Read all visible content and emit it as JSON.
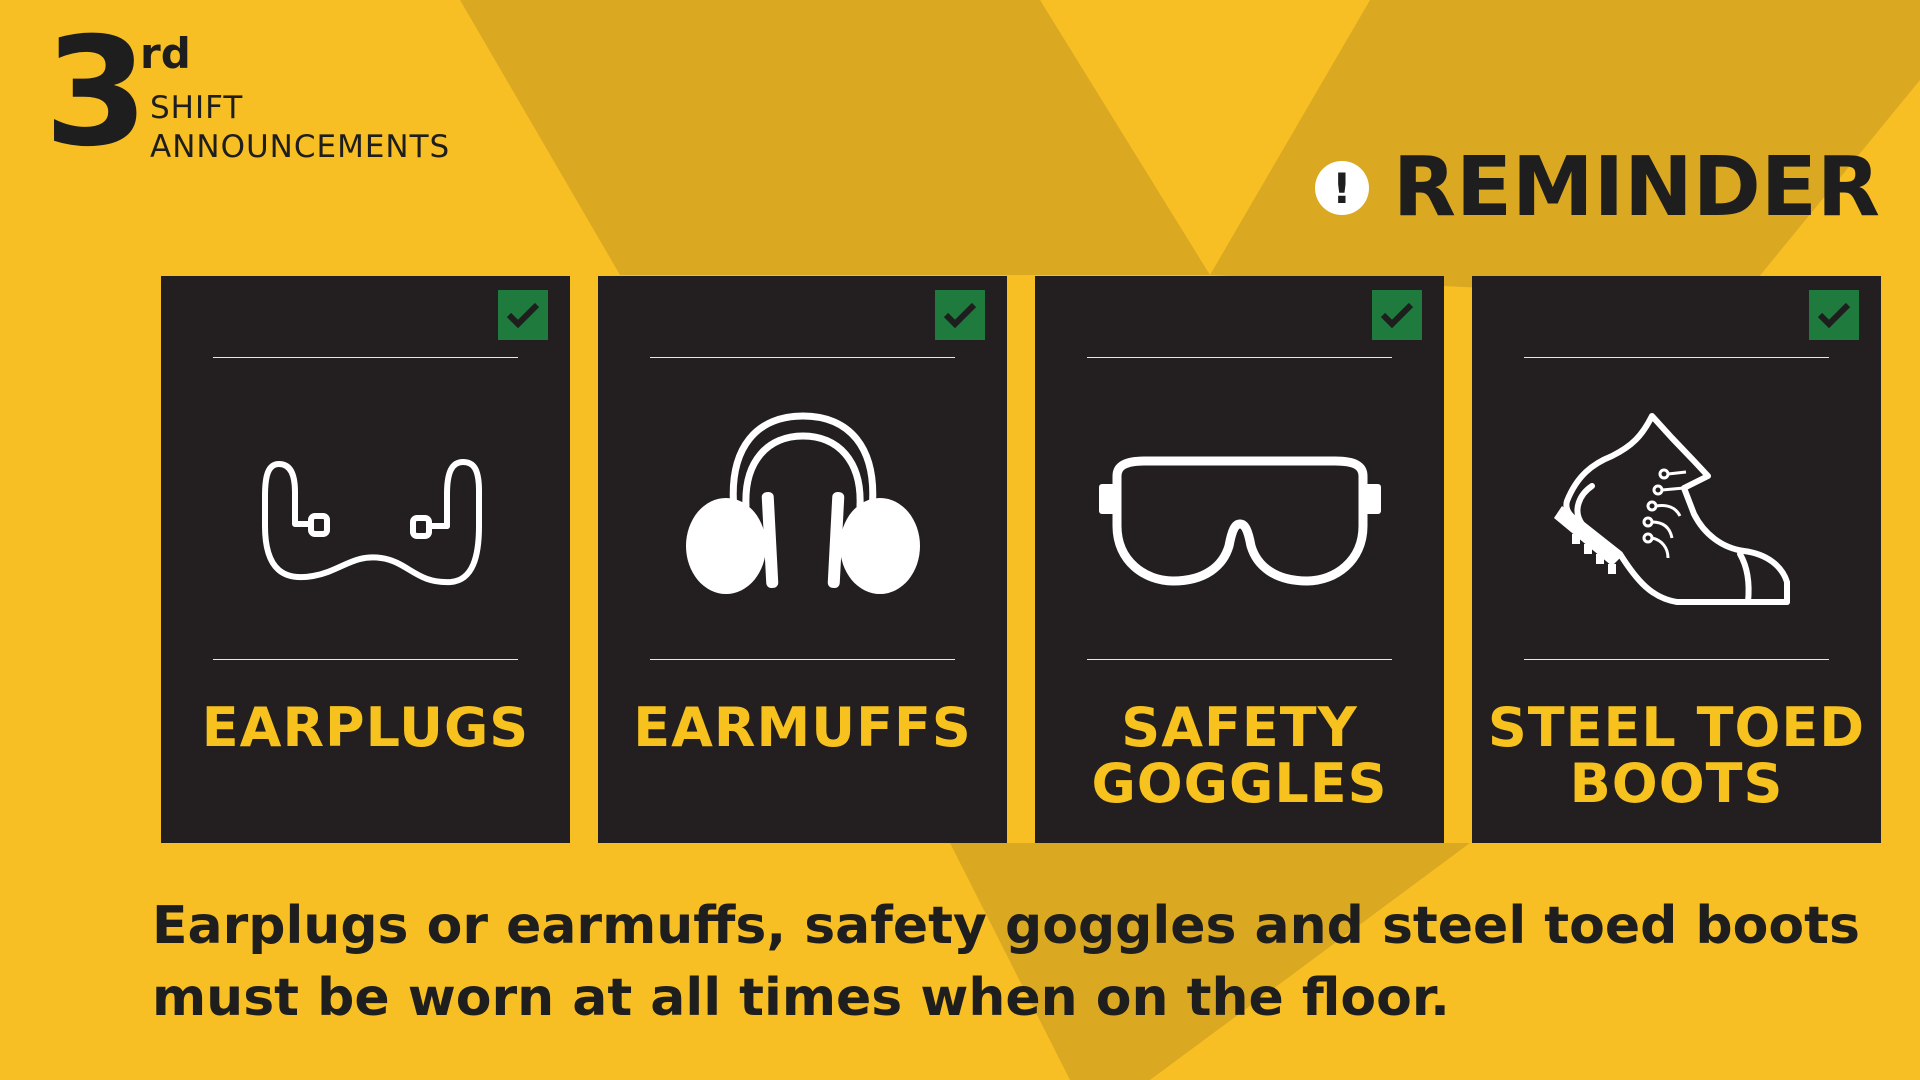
{
  "colors": {
    "background": "#f8bf24",
    "background_shade": "#dba822",
    "card": "#231f20",
    "label": "#f7c21e",
    "check": "#1f7a3d",
    "text": "#1e1e1e"
  },
  "header": {
    "number": "3",
    "superscript": "rd",
    "line1": "SHIFT",
    "line2": "ANNOUNCEMENTS"
  },
  "reminder": {
    "icon": "exclamation-icon",
    "label": "REMINDER"
  },
  "cards": [
    {
      "icon": "earplugs-icon",
      "label_lines": [
        "EARPLUGS"
      ],
      "checked": true
    },
    {
      "icon": "earmuffs-icon",
      "label_lines": [
        "EARMUFFS"
      ],
      "checked": true
    },
    {
      "icon": "safety-goggles-icon",
      "label_lines": [
        "SAFETY",
        "GOGGLES"
      ],
      "checked": true
    },
    {
      "icon": "steel-toed-boot-icon",
      "label_lines": [
        "STEEL TOED",
        "BOOTS"
      ],
      "checked": true
    }
  ],
  "message": {
    "line1": "Earplugs or earmuffs, safety goggles and steel toed boots",
    "line2": "must be worn at all times when on the floor."
  }
}
